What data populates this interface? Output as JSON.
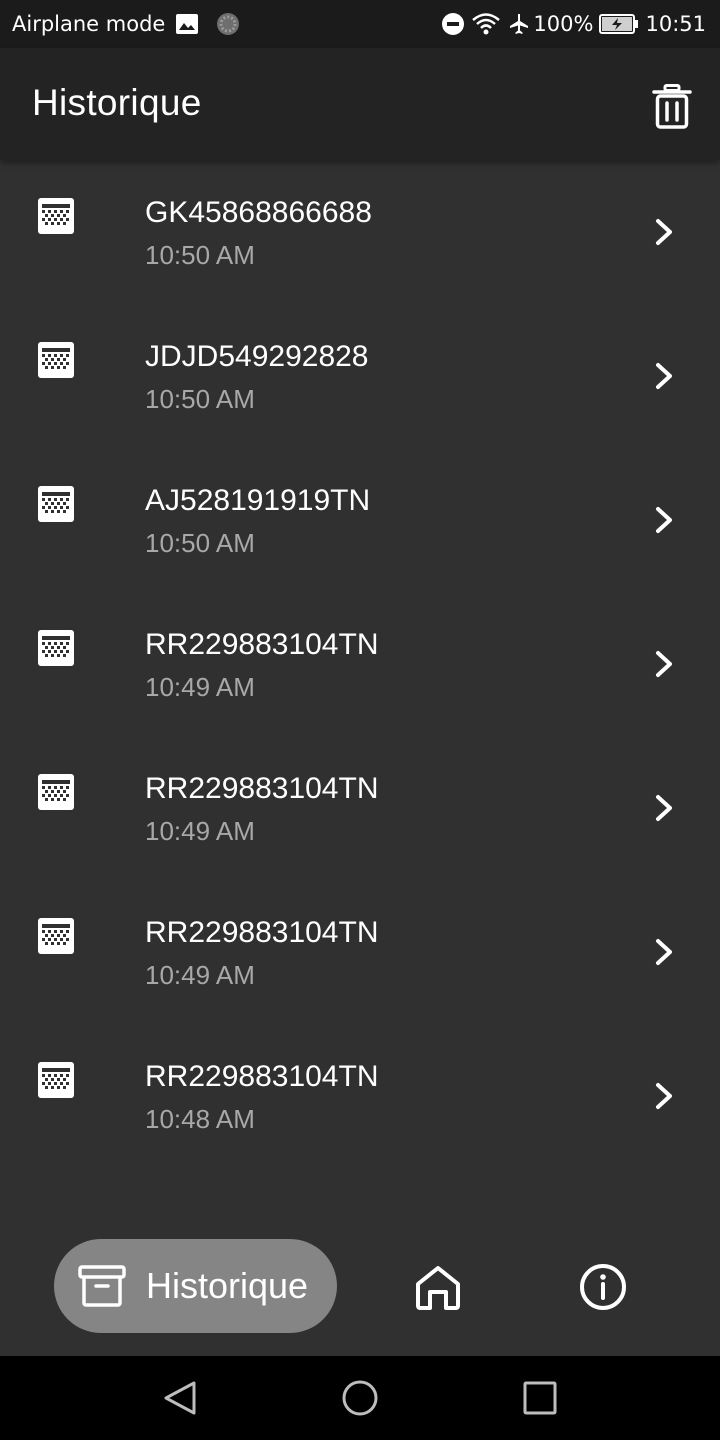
{
  "status_bar": {
    "left_text": "Airplane mode",
    "battery": "100%",
    "time": "10:51",
    "icons": [
      "image-icon",
      "loading-icon",
      "do-not-disturb-icon",
      "wifi-icon",
      "airplane-icon",
      "battery-charging-icon"
    ]
  },
  "app_bar": {
    "title": "Historique",
    "action_icon": "trash-icon"
  },
  "history": {
    "items": [
      {
        "code": "GK45868866688",
        "time": "10:50 AM"
      },
      {
        "code": "JDJD549292828",
        "time": "10:50 AM"
      },
      {
        "code": "AJ528191919TN",
        "time": "10:50 AM"
      },
      {
        "code": "RR229883104TN",
        "time": "10:49 AM"
      },
      {
        "code": "RR229883104TN",
        "time": "10:49 AM"
      },
      {
        "code": "RR229883104TN",
        "time": "10:49 AM"
      },
      {
        "code": "RR229883104TN",
        "time": "10:48 AM"
      }
    ]
  },
  "bottom_nav": {
    "active_label": "Historique",
    "items": [
      "archive-icon",
      "home-icon",
      "info-icon"
    ]
  },
  "system_nav": {
    "items": [
      "back-icon",
      "home-circle-icon",
      "recents-icon"
    ]
  },
  "colors": {
    "background": "#303030",
    "app_bar": "#232323",
    "status_bar": "#1b1b1b",
    "active_pill": "#858585",
    "secondary_text": "#a8a8a8"
  }
}
